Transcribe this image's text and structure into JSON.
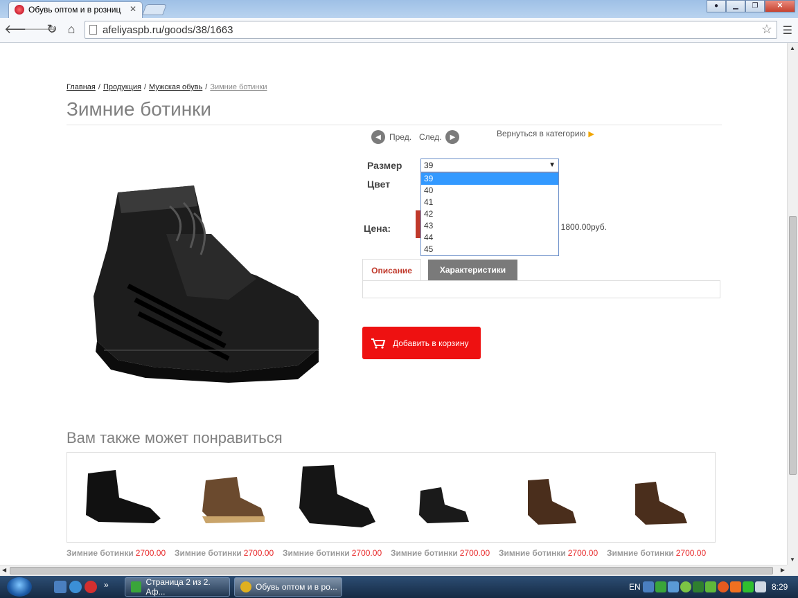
{
  "browser": {
    "tab_title": "Обувь оптом и в розниц",
    "url": "afeliyaspb.ru/goods/38/1663",
    "colors": {
      "active_tab_favicon": "#c0392b"
    }
  },
  "page": {
    "breadcrumb": [
      "Главная",
      "Продукция",
      "Мужская обувь",
      "Зимние ботинки"
    ],
    "breadcrumb_sep": "/",
    "title": "Зимние ботинки",
    "prev_label": "Пред.",
    "next_label": "След.",
    "back_to_category": "Вернуться в категорию",
    "size_label": "Размер",
    "color_label": "Цвет",
    "price_label": "Цена:",
    "size_selected": "39",
    "size_options": [
      "39",
      "40",
      "41",
      "42",
      "43",
      "44",
      "45"
    ],
    "retail_price_text": ": 1800.00руб.",
    "tab_description": "Описание",
    "tab_specs": "Характеристики",
    "add_to_cart": "Добавить в корзину",
    "recommend_title": "Вам также может понравиться",
    "recommendations": [
      {
        "name": "Зимние ботинки",
        "price": "2700.00"
      },
      {
        "name": "Зимние ботинки",
        "price": "2700.00"
      },
      {
        "name": "Зимние ботинки",
        "price": "2700.00"
      },
      {
        "name": "Зимние ботинки",
        "price": "2700.00"
      },
      {
        "name": "Зимние ботинки",
        "price": "2700.00"
      },
      {
        "name": "Зимние ботинки",
        "price": "2700.00"
      }
    ],
    "colors": {
      "accent_red": "#ee1111",
      "price_red": "#e8292a",
      "title_gray": "#808080"
    }
  },
  "taskbar": {
    "tasks": [
      {
        "label": "Страница 2 из 2. Аф..."
      },
      {
        "label": "Обувь оптом и в ро..."
      }
    ],
    "lang": "EN",
    "time": "8:29"
  }
}
